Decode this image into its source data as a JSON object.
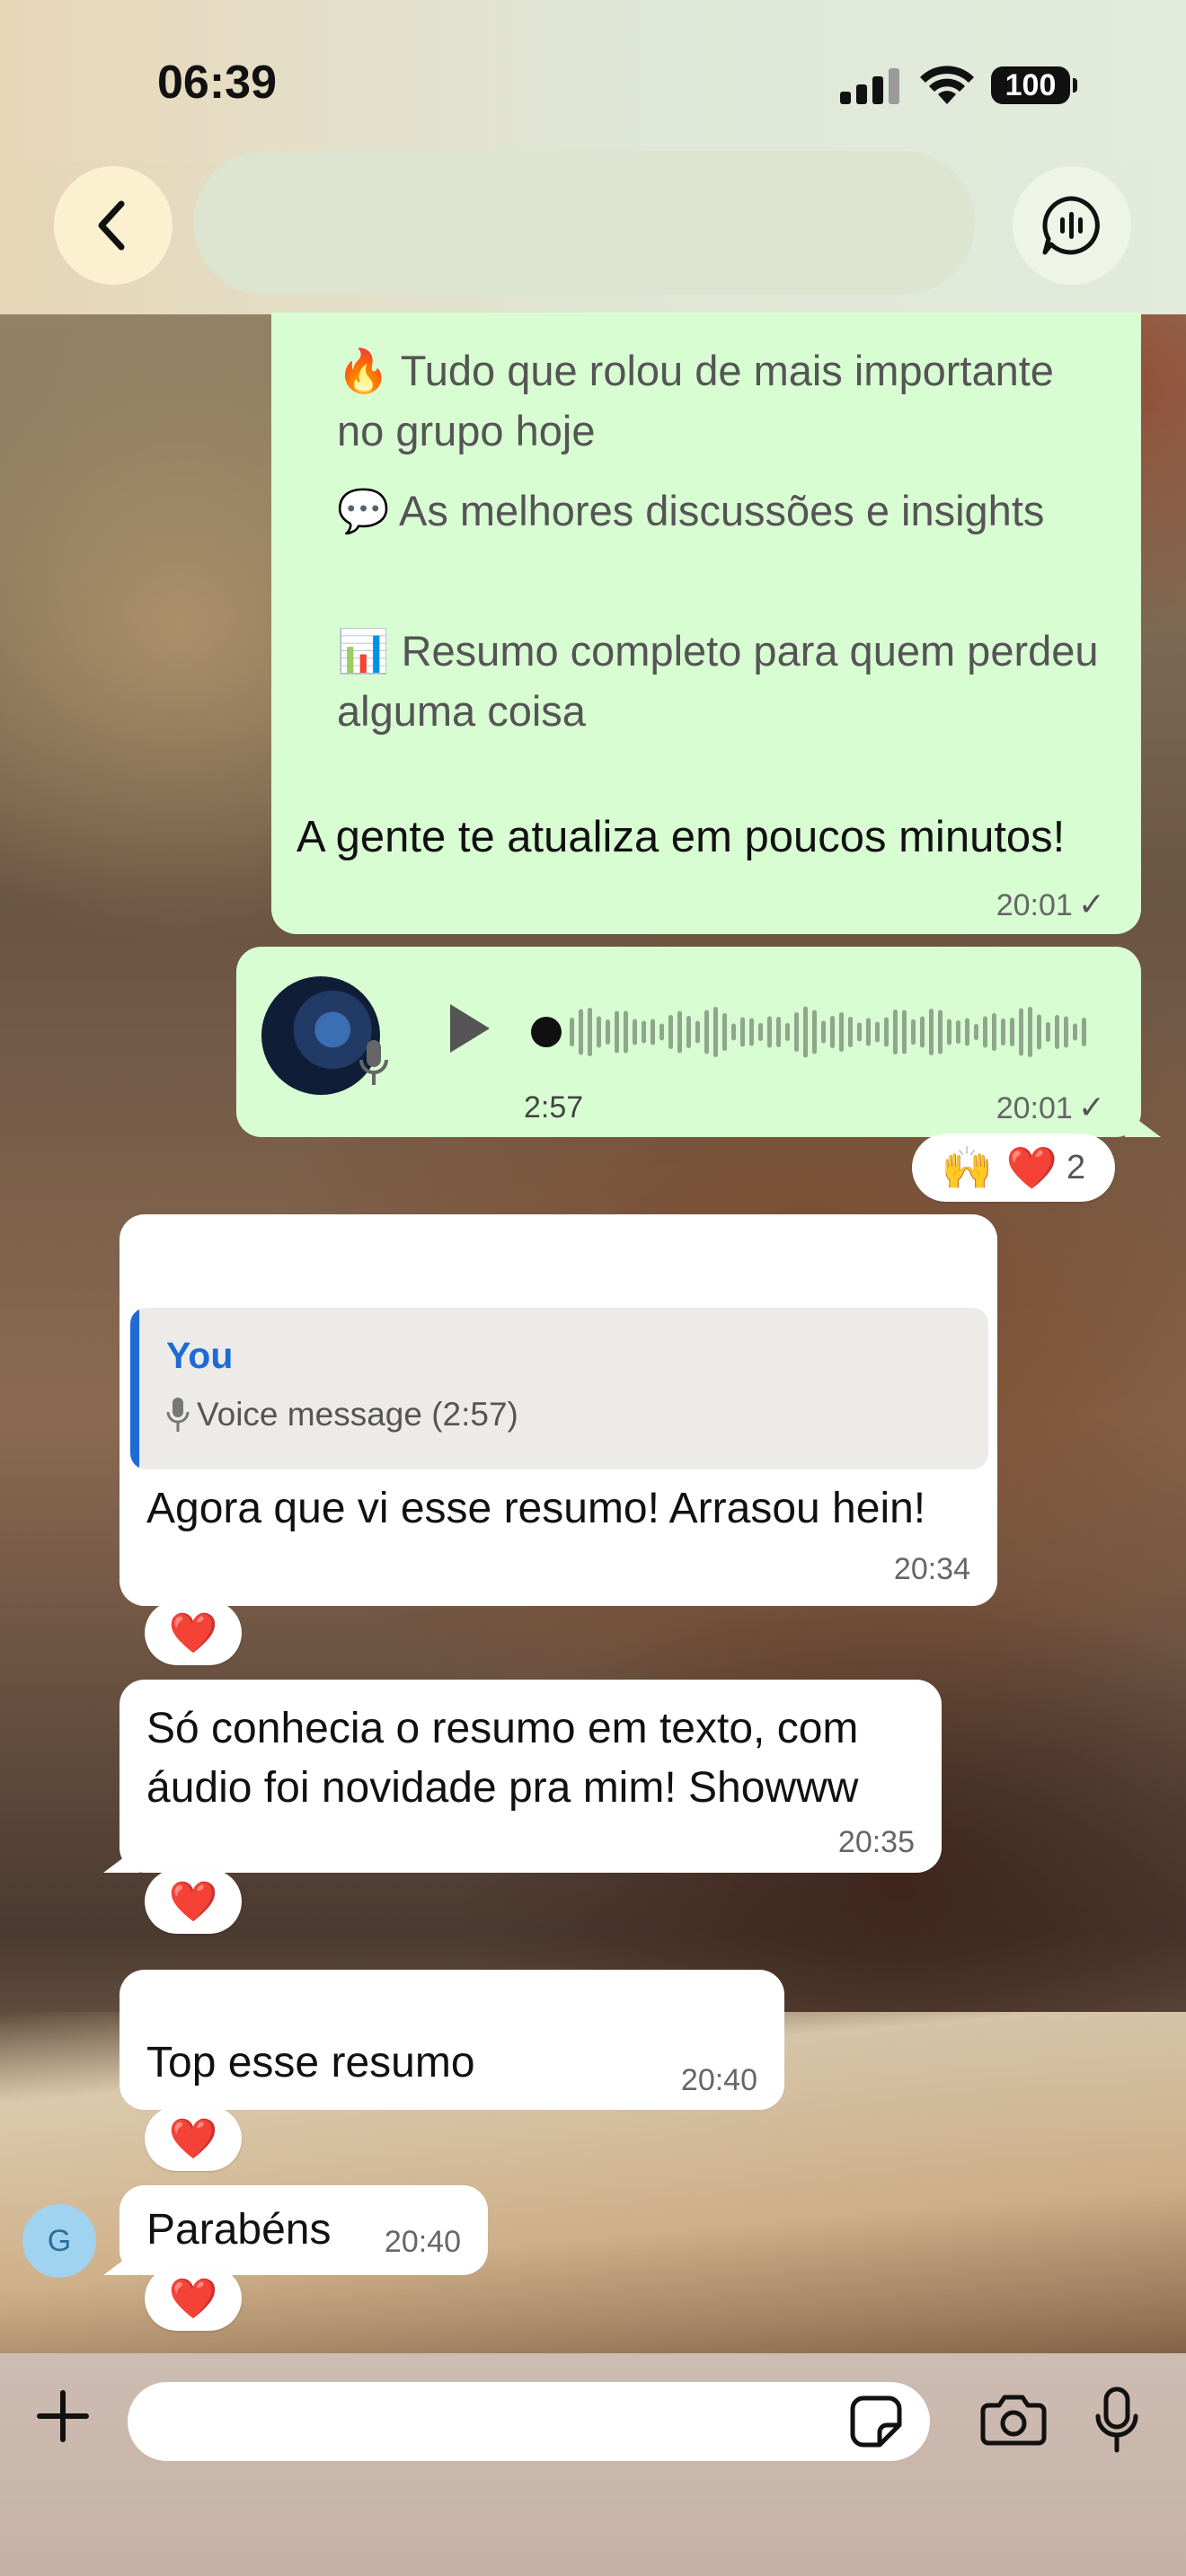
{
  "status_bar": {
    "time": "06:39",
    "battery": "100"
  },
  "chat": {
    "summary_message": {
      "bullets": [
        {
          "icon": "🔥",
          "text": "Tudo que rolou de mais importante no grupo hoje"
        },
        {
          "icon": "💬",
          "text": "As melhores discussões e insights"
        },
        {
          "icon": "📊",
          "text": "Resumo completo para quem perdeu alguma coisa"
        }
      ],
      "text": "A gente te atualiza em poucos minutos!",
      "time": "20:01"
    },
    "voice_message": {
      "duration": "2:57",
      "time": "20:01",
      "reactions": "🙌 ❤️",
      "reaction_count": "2"
    },
    "reply_message": {
      "quote_author": "You",
      "quote_text": "Voice message (2:57)",
      "text": "Agora que vi esse resumo! Arrasou hein!",
      "time": "20:34",
      "reaction": "❤️"
    },
    "message_2": {
      "text": "Só conhecia o resumo em texto, com áudio foi novidade pra mim! Showww",
      "time": "20:35",
      "reaction": "❤️"
    },
    "message_3": {
      "text": "Top esse resumo",
      "time": "20:40",
      "reaction": "❤️"
    },
    "message_4": {
      "text": "Parabéns",
      "time": "20:40",
      "reaction": "❤️",
      "sender_initial": "G"
    }
  },
  "composer": {
    "placeholder": ""
  },
  "colors": {
    "outgoing_bubble": "#d9fdd3",
    "incoming_bubble": "#ffffff",
    "quote_accent": "#1f6ad4"
  },
  "icons": [
    "back-arrow-icon",
    "voice-chat-icon",
    "play-icon",
    "mic-icon",
    "plus-icon",
    "sticker-icon",
    "camera-icon",
    "checkmark-icon",
    "cellular-signal-icon",
    "wifi-icon",
    "battery-icon"
  ]
}
